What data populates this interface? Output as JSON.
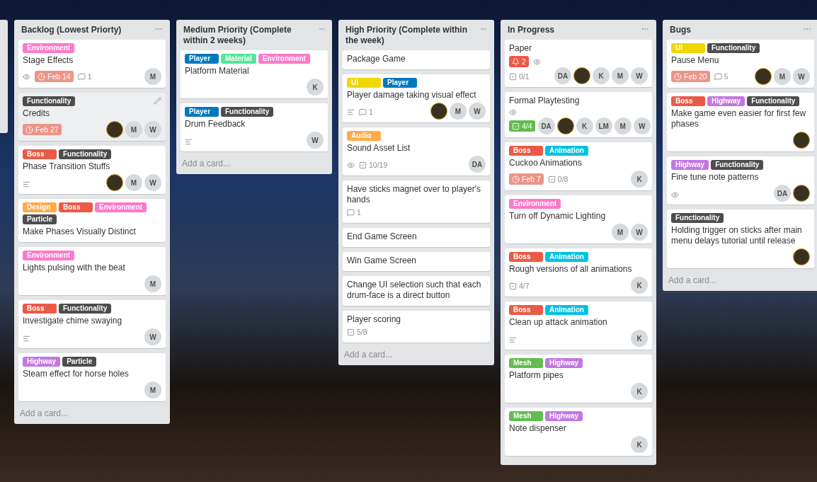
{
  "lists": [
    {
      "title": "Backlog (Lowest Priorty)",
      "add_card": "Add a card...",
      "cards": [
        {
          "labels": [
            {
              "text": "Environment",
              "color": "#ff78cb"
            }
          ],
          "title": "Stage Effects",
          "hovered": false,
          "badges": [
            {
              "kind": "watch"
            },
            {
              "kind": "due",
              "text": "Feb 14"
            },
            {
              "kind": "comments",
              "text": "1"
            }
          ],
          "members": [
            {
              "kind": "initials",
              "text": "M"
            }
          ]
        },
        {
          "labels": [
            {
              "text": "Functionality",
              "color": "#4d4d4d"
            }
          ],
          "title": "Credits",
          "hovered": true,
          "badges": [
            {
              "kind": "due",
              "text": "Feb 27"
            }
          ],
          "members": [
            {
              "kind": "avatar"
            },
            {
              "kind": "initials",
              "text": "M"
            },
            {
              "kind": "initials",
              "text": "W"
            }
          ]
        },
        {
          "labels": [
            {
              "text": "Boss",
              "color": "#eb5a46"
            },
            {
              "text": "Functionality",
              "color": "#4d4d4d"
            }
          ],
          "title": "Phase Transition Stuffs",
          "hovered": false,
          "badges": [
            {
              "kind": "description"
            }
          ],
          "members": [
            {
              "kind": "avatar"
            },
            {
              "kind": "initials",
              "text": "M"
            },
            {
              "kind": "initials",
              "text": "W"
            }
          ]
        },
        {
          "labels": [
            {
              "text": "Design",
              "color": "#ffab4a"
            },
            {
              "text": "Boss",
              "color": "#eb5a46"
            },
            {
              "text": "Environment",
              "color": "#ff78cb"
            },
            {
              "text": "Particle",
              "color": "#4d4d4d"
            }
          ],
          "title": "Make Phases Visually Distinct",
          "hovered": false
        },
        {
          "labels": [
            {
              "text": "Environment",
              "color": "#ff78cb"
            }
          ],
          "title": "Lights pulsing with the beat",
          "hovered": false,
          "members": [
            {
              "kind": "initials",
              "text": "M"
            }
          ]
        },
        {
          "labels": [
            {
              "text": "Boss",
              "color": "#eb5a46"
            },
            {
              "text": "Functionality",
              "color": "#4d4d4d"
            }
          ],
          "title": "Investigate chime swaying",
          "hovered": false,
          "badges": [
            {
              "kind": "description"
            }
          ],
          "members": [
            {
              "kind": "initials",
              "text": "W"
            }
          ]
        },
        {
          "labels": [
            {
              "text": "Highway",
              "color": "#c377e0"
            },
            {
              "text": "Particle",
              "color": "#4d4d4d"
            }
          ],
          "title": "Steam effect for horse holes",
          "hovered": false,
          "members": [
            {
              "kind": "initials",
              "text": "M"
            }
          ]
        }
      ]
    },
    {
      "title": "Medium Priority (Complete within 2 weeks)",
      "add_card": "Add a card...",
      "cards": [
        {
          "labels": [
            {
              "text": "Player",
              "color": "#0079bf"
            },
            {
              "text": "Material",
              "color": "#51e898"
            },
            {
              "text": "Environment",
              "color": "#ff78cb"
            }
          ],
          "title": "Platform Material",
          "hovered": false,
          "members": [
            {
              "kind": "initials",
              "text": "K"
            }
          ]
        },
        {
          "labels": [
            {
              "text": "Player",
              "color": "#0079bf"
            },
            {
              "text": "Functionality",
              "color": "#4d4d4d"
            }
          ],
          "title": "Drum Feedback",
          "hovered": false,
          "badges": [
            {
              "kind": "description"
            }
          ],
          "members": [
            {
              "kind": "initials",
              "text": "W"
            }
          ]
        }
      ]
    },
    {
      "title": "High Priority (Complete within the week)",
      "add_card": "Add a card...",
      "cards": [
        {
          "title": "Package Game",
          "hovered": false
        },
        {
          "labels": [
            {
              "text": "UI",
              "color": "#f2d600"
            },
            {
              "text": "Player",
              "color": "#0079bf"
            }
          ],
          "title": "Player damage taking visual effect",
          "hovered": false,
          "badges": [
            {
              "kind": "description"
            },
            {
              "kind": "comments",
              "text": "1"
            }
          ],
          "members": [
            {
              "kind": "avatar"
            },
            {
              "kind": "initials",
              "text": "M"
            },
            {
              "kind": "initials",
              "text": "W"
            }
          ]
        },
        {
          "labels": [
            {
              "text": "Audio",
              "color": "#ffab4a"
            }
          ],
          "title": "Sound Asset List",
          "hovered": false,
          "badges": [
            {
              "kind": "watch"
            },
            {
              "kind": "checklist",
              "text": "10/19",
              "complete": false
            }
          ],
          "members": [
            {
              "kind": "initials",
              "text": "DA"
            }
          ]
        },
        {
          "title": "Have sticks magnet over to player's hands",
          "hovered": false,
          "badges": [
            {
              "kind": "comments",
              "text": "1"
            }
          ]
        },
        {
          "title": "End Game Screen",
          "hovered": false
        },
        {
          "title": "Win Game Screen",
          "hovered": false
        },
        {
          "title": "Change UI selection such that each drum-face is a direct button",
          "hovered": false
        },
        {
          "title": "Player scoring",
          "hovered": false,
          "badges": [
            {
              "kind": "checklist",
              "text": "5/8",
              "complete": false
            }
          ]
        }
      ]
    },
    {
      "title": "In Progress",
      "cards": [
        {
          "title": "Paper",
          "hovered": false,
          "badges": [
            {
              "kind": "notification",
              "text": "2"
            },
            {
              "kind": "watch"
            },
            {
              "kind": "checklist",
              "text": "0/1",
              "complete": false
            }
          ],
          "members": [
            {
              "kind": "initials",
              "text": "DA"
            },
            {
              "kind": "avatar"
            },
            {
              "kind": "initials",
              "text": "K"
            },
            {
              "kind": "initials",
              "text": "M"
            },
            {
              "kind": "initials",
              "text": "W"
            }
          ]
        },
        {
          "title": "Formal Playtesting",
          "hovered": false,
          "badges": [
            {
              "kind": "watch"
            },
            {
              "kind": "checklist",
              "text": "4/4",
              "complete": true
            }
          ],
          "members": [
            {
              "kind": "initials",
              "text": "DA"
            },
            {
              "kind": "avatar"
            },
            {
              "kind": "initials",
              "text": "K"
            },
            {
              "kind": "initials",
              "text": "LM"
            },
            {
              "kind": "initials",
              "text": "M"
            },
            {
              "kind": "initials",
              "text": "W"
            }
          ]
        },
        {
          "labels": [
            {
              "text": "Boss",
              "color": "#eb5a46"
            },
            {
              "text": "Animation",
              "color": "#00c2e0"
            }
          ],
          "title": "Cuckoo Animations",
          "hovered": false,
          "badges": [
            {
              "kind": "due",
              "text": "Feb 7"
            },
            {
              "kind": "checklist",
              "text": "0/8",
              "complete": false
            }
          ],
          "members": [
            {
              "kind": "initials",
              "text": "K"
            }
          ]
        },
        {
          "labels": [
            {
              "text": "Environment",
              "color": "#ff78cb"
            }
          ],
          "title": "Turn off Dynamic Lighting",
          "hovered": false,
          "members": [
            {
              "kind": "initials",
              "text": "M"
            },
            {
              "kind": "initials",
              "text": "W"
            }
          ]
        },
        {
          "labels": [
            {
              "text": "Boss",
              "color": "#eb5a46"
            },
            {
              "text": "Animation",
              "color": "#00c2e0"
            }
          ],
          "title": "Rough versions of all animations",
          "hovered": false,
          "badges": [
            {
              "kind": "checklist",
              "text": "4/7",
              "complete": false
            }
          ],
          "members": [
            {
              "kind": "initials",
              "text": "K"
            }
          ]
        },
        {
          "labels": [
            {
              "text": "Boss",
              "color": "#eb5a46"
            },
            {
              "text": "Animation",
              "color": "#00c2e0"
            }
          ],
          "title": "Clean up attack animation",
          "hovered": false,
          "badges": [
            {
              "kind": "description"
            }
          ],
          "members": [
            {
              "kind": "initials",
              "text": "K"
            }
          ]
        },
        {
          "labels": [
            {
              "text": "Mesh",
              "color": "#61bd4f"
            },
            {
              "text": "Highway",
              "color": "#c377e0"
            }
          ],
          "title": "Platform pipes",
          "hovered": false,
          "members": [
            {
              "kind": "initials",
              "text": "K"
            }
          ]
        },
        {
          "labels": [
            {
              "text": "Mesh",
              "color": "#61bd4f"
            },
            {
              "text": "Highway",
              "color": "#c377e0"
            }
          ],
          "title": "Note dispenser",
          "hovered": false,
          "members": [
            {
              "kind": "initials",
              "text": "K"
            }
          ]
        }
      ]
    },
    {
      "title": "Bugs",
      "add_card": "Add a card...",
      "cards": [
        {
          "labels": [
            {
              "text": "UI",
              "color": "#f2d600"
            },
            {
              "text": "Functionality",
              "color": "#4d4d4d"
            }
          ],
          "title": "Pause Menu",
          "hovered": false,
          "badges": [
            {
              "kind": "due",
              "text": "Feb 20"
            },
            {
              "kind": "comments",
              "text": "5"
            }
          ],
          "members": [
            {
              "kind": "avatar"
            },
            {
              "kind": "initials",
              "text": "M"
            },
            {
              "kind": "initials",
              "text": "W"
            }
          ]
        },
        {
          "labels": [
            {
              "text": "Boss",
              "color": "#eb5a46"
            },
            {
              "text": "Highway",
              "color": "#c377e0"
            },
            {
              "text": "Functionality",
              "color": "#4d4d4d"
            }
          ],
          "title": "Make game even easier for first few phases",
          "hovered": false,
          "members": [
            {
              "kind": "avatar"
            }
          ]
        },
        {
          "labels": [
            {
              "text": "Highway",
              "color": "#c377e0"
            },
            {
              "text": "Functionality",
              "color": "#4d4d4d"
            }
          ],
          "title": "Fine tune note patterns",
          "hovered": false,
          "badges": [
            {
              "kind": "watch"
            }
          ],
          "members": [
            {
              "kind": "initials",
              "text": "DA"
            },
            {
              "kind": "avatar"
            }
          ]
        },
        {
          "labels": [
            {
              "text": "Functionality",
              "color": "#4d4d4d"
            }
          ],
          "title": "Holding trigger on sticks after main menu delays tutorial until release",
          "hovered": false,
          "members": [
            {
              "kind": "avatar"
            }
          ]
        }
      ]
    }
  ]
}
